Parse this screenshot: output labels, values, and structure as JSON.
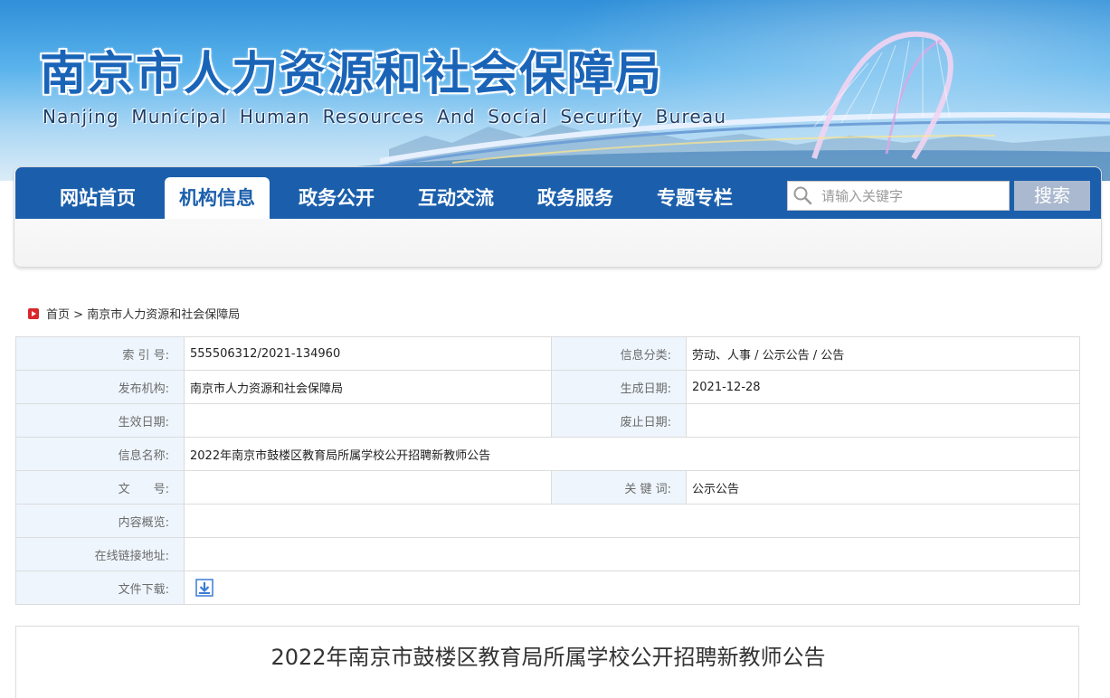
{
  "banner": {
    "title": "南京市人力资源和社会保障局",
    "subtitle": "Nanjing Municipal Human Resources And Social Security Bureau"
  },
  "nav": {
    "items": [
      {
        "label": "网站首页"
      },
      {
        "label": "机构信息",
        "active": true
      },
      {
        "label": "政务公开"
      },
      {
        "label": "互动交流"
      },
      {
        "label": "政务服务"
      },
      {
        "label": "专题专栏"
      }
    ],
    "search_placeholder": "请输入关键字",
    "search_button": "搜索"
  },
  "breadcrumb": {
    "home": "首页",
    "separator": ">",
    "current": "南京市人力资源和社会保障局"
  },
  "info": {
    "index_label": "索 引 号:",
    "index_value": "555506312/2021-134960",
    "category_label": "信息分类:",
    "category_value": "劳动、人事 / 公示公告 / 公告",
    "publisher_label": "发布机构:",
    "publisher_value": "南京市人力资源和社会保障局",
    "created_label": "生成日期:",
    "created_value": "2021-12-28",
    "effective_label": "生效日期:",
    "effective_value": "",
    "expiry_label": "废止日期:",
    "expiry_value": "",
    "name_label": "信息名称:",
    "name_value": "2022年南京市鼓楼区教育局所属学校公开招聘新教师公告",
    "doc_no_label": "文　　号:",
    "doc_no_value": "",
    "keywords_label": "关 键 词:",
    "keywords_value": "公示公告",
    "summary_label": "内容概览:",
    "summary_value": "",
    "link_label": "在线链接地址:",
    "link_value": "",
    "download_label": "文件下载:"
  },
  "article": {
    "title": "2022年南京市鼓楼区教育局所属学校公开招聘新教师公告"
  },
  "colors": {
    "nav_blue": "#1b5fac",
    "label_bg": "#eef5fd",
    "breadcrumb_icon": "#d9262c"
  }
}
